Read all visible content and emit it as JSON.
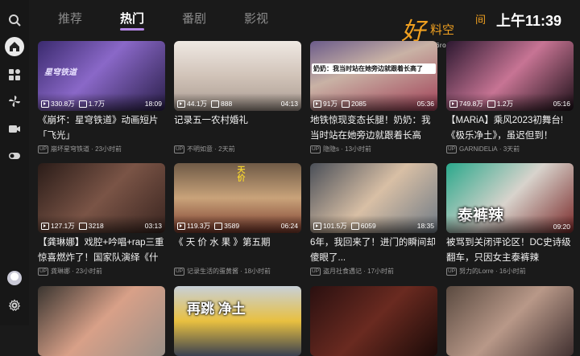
{
  "tabs": [
    "推荐",
    "热门",
    "番剧",
    "影视"
  ],
  "active_tab": 1,
  "logo": {
    "big": "好",
    "mid": "料空",
    "jian": "间",
    "sub": "h6room.com"
  },
  "clock": "上午11:39",
  "sidebar": {
    "icons": [
      "search-icon",
      "home-icon",
      "grid-icon",
      "pinwheel-icon",
      "video-icon",
      "toggle-icon"
    ],
    "bottom": [
      "avatar",
      "settings-icon"
    ]
  },
  "colors": {
    "accent": "#b487e5",
    "background": "#1a1a1a",
    "logo": "#f0a020"
  },
  "videos": [
    {
      "views": "330.8万",
      "danmaku": "1.7万",
      "duration": "18:09",
      "title": "《崩坏：星穹铁道》动画短片「飞光」",
      "uploader": "崩坏星穹铁道",
      "time": "23小时前",
      "thumb_text": "星穹铁道"
    },
    {
      "views": "44.1万",
      "danmaku": "888",
      "duration": "04:13",
      "title": "记录五一农村婚礼",
      "uploader": "不明如意",
      "time": "2天前",
      "thumb_text": ""
    },
    {
      "views": "91万",
      "danmaku": "2085",
      "duration": "05:36",
      "title": "地铁惊现变态长腿！奶奶：我当时站在她旁边就跟着长高",
      "uploader": "隐隐s",
      "time": "13小时前",
      "thumb_text": "奶奶：我当时站在她旁边就跟着长高了"
    },
    {
      "views": "749.8万",
      "danmaku": "1.2万",
      "duration": "05:16",
      "title": "【MARiA】乘风2023初舞台!《极乐净土》，虽迟但到！",
      "uploader": "GARNiDELiA",
      "time": "3天前",
      "thumb_text": ""
    },
    {
      "views": "127.1万",
      "danmaku": "3218",
      "duration": "03:13",
      "title": "【龚琳娜】戏腔+吟唱+rap三重惊喜燃炸了！国家队演绎《什",
      "uploader": "龚琳娜",
      "time": "23小时前",
      "thumb_text": ""
    },
    {
      "views": "119.3万",
      "danmaku": "3589",
      "duration": "06:24",
      "title": "《 天 价 水 果 》第五期",
      "uploader": "记录生活的蛋黄酱",
      "time": "18小时前",
      "thumb_text": "天价"
    },
    {
      "views": "101.5万",
      "danmaku": "6059",
      "duration": "18:35",
      "title": "6年，我回来了！进门的瞬间却傻眼了...",
      "uploader": "盗月社食遇记",
      "time": "17小时前",
      "thumb_text": ""
    },
    {
      "views": "",
      "danmaku": "",
      "duration": "09:20",
      "title": "被骂到关闭评论区！DC史诗级翻车，只因女主泰裤辣",
      "uploader": "努力的Lorre",
      "time": "16小时前",
      "thumb_text": "泰裤辣"
    },
    {
      "views": "",
      "danmaku": "",
      "duration": "",
      "title": "",
      "uploader": "",
      "time": "",
      "thumb_text": ""
    },
    {
      "views": "",
      "danmaku": "",
      "duration": "",
      "title": "",
      "uploader": "",
      "time": "",
      "thumb_text": "再跳 净土"
    },
    {
      "views": "",
      "danmaku": "",
      "duration": "",
      "title": "",
      "uploader": "",
      "time": "",
      "thumb_text": ""
    },
    {
      "views": "",
      "danmaku": "",
      "duration": "",
      "title": "",
      "uploader": "",
      "time": "",
      "thumb_text": ""
    }
  ]
}
